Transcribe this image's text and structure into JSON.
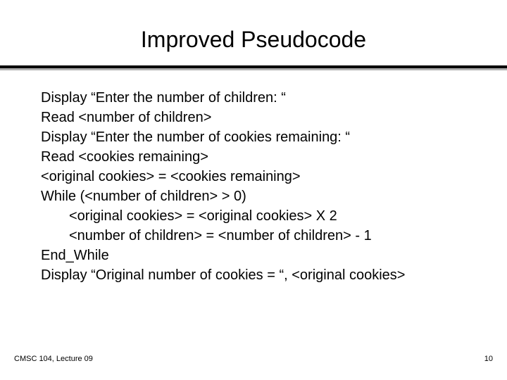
{
  "title": "Improved Pseudocode",
  "lines": {
    "l0": "Display “Enter the number of children:  “",
    "l1": "Read <number of children>",
    "l2": "Display “Enter the number of cookies remaining:  “",
    "l3": "Read <cookies remaining>",
    "l4": "<original cookies> = <cookies remaining>",
    "l5": "While (<number of children>  >  0)",
    "l6": "<original cookies> =  <original cookies> X 2",
    "l7": "<number of children> = <number of children> - 1",
    "l8": "End_While",
    "l9": "Display “Original number of cookies = “, <original cookies>"
  },
  "footer": {
    "left": "CMSC 104, Lecture 09",
    "right": "10"
  }
}
